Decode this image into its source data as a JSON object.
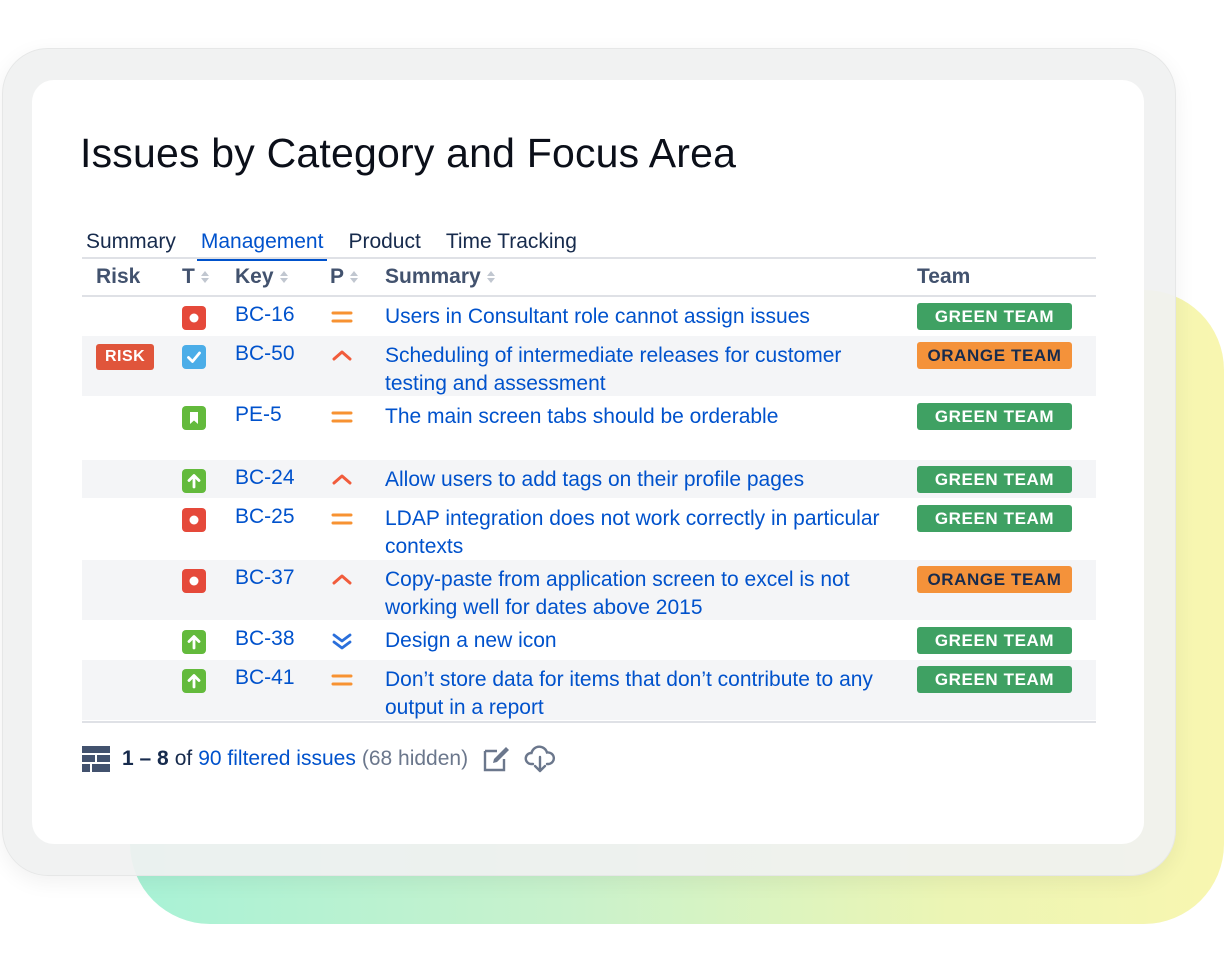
{
  "title": "Issues by Category and Focus Area",
  "tabs": [
    {
      "label": "Summary",
      "active": false
    },
    {
      "label": "Management",
      "active": true
    },
    {
      "label": "Product",
      "active": false
    },
    {
      "label": "Time Tracking",
      "active": false
    }
  ],
  "columns": {
    "risk": "Risk",
    "type": "T",
    "key": "Key",
    "priority": "P",
    "summary": "Summary",
    "team": "Team"
  },
  "rows": [
    {
      "risk": "",
      "type": "bug",
      "key": "BC-16",
      "priority": "medium",
      "summary": "Users in Consultant role cannot assign issues",
      "team": "GREEN TEAM",
      "team_color": "green"
    },
    {
      "risk": "RISK",
      "type": "task",
      "key": "BC-50",
      "priority": "high",
      "summary": "Scheduling of intermediate releases for customer testing and assessment",
      "team": "ORANGE TEAM",
      "team_color": "orange"
    },
    {
      "risk": "",
      "type": "story",
      "key": "PE-5",
      "priority": "medium",
      "summary": "The main screen tabs should be orderable",
      "team": "GREEN TEAM",
      "team_color": "green"
    },
    {
      "risk": "",
      "type": "improvement",
      "key": "BC-24",
      "priority": "high",
      "summary": "Allow users to add tags on their profile pages",
      "team": "GREEN TEAM",
      "team_color": "green"
    },
    {
      "risk": "",
      "type": "bug",
      "key": "BC-25",
      "priority": "medium",
      "summary": "LDAP integration does not work correctly in particular contexts",
      "team": "GREEN TEAM",
      "team_color": "green"
    },
    {
      "risk": "",
      "type": "bug",
      "key": "BC-37",
      "priority": "high",
      "summary": "Copy-paste from application screen to excel is not working well for dates above 2015",
      "team": "ORANGE TEAM",
      "team_color": "orange"
    },
    {
      "risk": "",
      "type": "improvement",
      "key": "BC-38",
      "priority": "lowest",
      "summary": "Design a new icon",
      "team": "GREEN TEAM",
      "team_color": "green"
    },
    {
      "risk": "",
      "type": "improvement",
      "key": "BC-41",
      "priority": "medium",
      "summary": "Don’t store data for items that don’t contribute to any output in a report",
      "team": "GREEN TEAM",
      "team_color": "green"
    }
  ],
  "footer": {
    "range": "1 – 8",
    "of": "of",
    "link": "90 filtered issues",
    "hidden": "(68 hidden)"
  },
  "icons": {
    "table_layout": "table-layout-icon",
    "edit": "edit-icon",
    "export": "cloud-download-icon"
  },
  "colors": {
    "link": "#0052cc",
    "green_team": "#3fa163",
    "orange_team": "#f4923a",
    "risk": "#e0553b",
    "bug": "#e5493a",
    "task": "#4bade8",
    "story": "#63ba3c",
    "improvement": "#63ba3c",
    "priority_medium": "#f79232",
    "priority_high": "#f15c3c",
    "priority_lowest": "#2a6fdb"
  }
}
